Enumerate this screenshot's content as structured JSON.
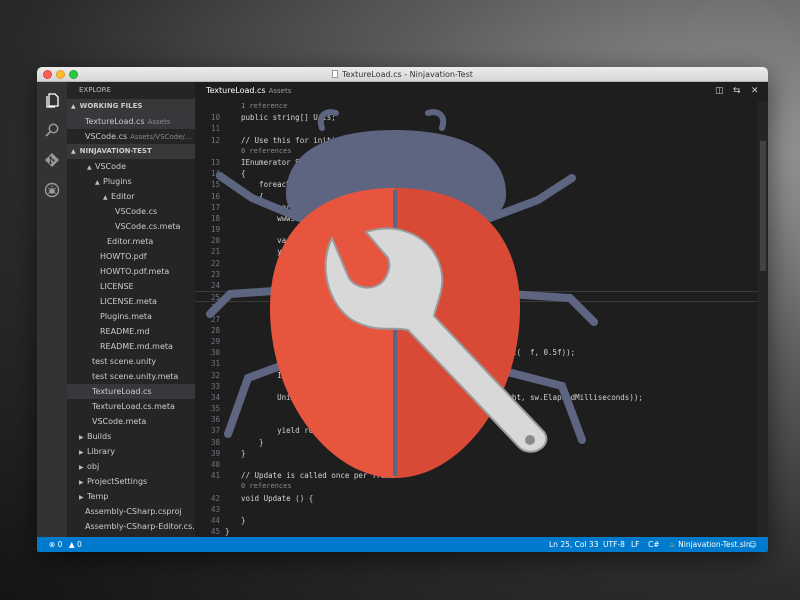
{
  "window": {
    "title": "TextureLoad.cs - Ninjavation-Test"
  },
  "activity_bar": {
    "icons": [
      "files-icon",
      "search-icon",
      "git-icon",
      "debug-icon"
    ]
  },
  "sidebar": {
    "header": "EXPLORE",
    "working_files_title": "WORKING FILES",
    "working_files": [
      {
        "name": "TextureLoad.cs",
        "path": "Assets"
      },
      {
        "name": "VSCode.cs",
        "path": "Assets/VSCode/..."
      }
    ],
    "project_title": "NINJAVATION-TEST",
    "tree": [
      {
        "label": "VSCode",
        "arrow": "▲",
        "indent": 20
      },
      {
        "label": "Plugins",
        "arrow": "▲",
        "indent": 28
      },
      {
        "label": "Editor",
        "arrow": "▲",
        "indent": 36
      },
      {
        "label": "VSCode.cs",
        "arrow": "",
        "indent": 48
      },
      {
        "label": "VSCode.cs.meta",
        "arrow": "",
        "indent": 48
      },
      {
        "label": "Editor.meta",
        "arrow": "",
        "indent": 40
      },
      {
        "label": "HOWTO.pdf",
        "arrow": "",
        "indent": 33
      },
      {
        "label": "HOWTO.pdf.meta",
        "arrow": "",
        "indent": 33
      },
      {
        "label": "LICENSE",
        "arrow": "",
        "indent": 33
      },
      {
        "label": "LICENSE.meta",
        "arrow": "",
        "indent": 33
      },
      {
        "label": "Plugins.meta",
        "arrow": "",
        "indent": 33
      },
      {
        "label": "README.md",
        "arrow": "",
        "indent": 33
      },
      {
        "label": "README.md.meta",
        "arrow": "",
        "indent": 33
      },
      {
        "label": "test scene.unity",
        "arrow": "",
        "indent": 25
      },
      {
        "label": "test scene.unity.meta",
        "arrow": "",
        "indent": 25
      },
      {
        "label": "TextureLoad.cs",
        "arrow": "",
        "indent": 25,
        "selected": true
      },
      {
        "label": "TextureLoad.cs.meta",
        "arrow": "",
        "indent": 25
      },
      {
        "label": "VSCode.meta",
        "arrow": "",
        "indent": 25
      },
      {
        "label": "Builds",
        "arrow": "▶",
        "indent": 12
      },
      {
        "label": "Library",
        "arrow": "▶",
        "indent": 12
      },
      {
        "label": "obj",
        "arrow": "▶",
        "indent": 12
      },
      {
        "label": "ProjectSettings",
        "arrow": "▶",
        "indent": 12
      },
      {
        "label": "Temp",
        "arrow": "▶",
        "indent": 12
      },
      {
        "label": "Assembly-CSharp.csproj",
        "arrow": "",
        "indent": 18
      },
      {
        "label": "Assembly-CSharp-Editor.cs...",
        "arrow": "",
        "indent": 18
      }
    ]
  },
  "editor": {
    "tab": {
      "name": "TextureLoad.cs",
      "folder": "Assets"
    },
    "code_lines": [
      {
        "n": "",
        "t": "1 reference",
        "k": "ref"
      },
      {
        "n": "10",
        "t": "public string[] Urls;",
        "k": "decl"
      },
      {
        "n": "11",
        "t": "",
        "k": ""
      },
      {
        "n": "12",
        "t": "// Use this for initialization",
        "k": "comment"
      },
      {
        "n": "",
        "t": "0 references",
        "k": "ref"
      },
      {
        "n": "13",
        "t": "IEnumerator Start()",
        "k": "type"
      },
      {
        "n": "14",
        "t": "{",
        "k": ""
      },
      {
        "n": "15",
        "t": "    foreach (var ur",
        "k": "kw"
      },
      {
        "n": "16",
        "t": "    {",
        "k": ""
      },
      {
        "n": "17",
        "t": "        var wwwsw =",
        "k": "kw"
      },
      {
        "n": "18",
        "t": "        wwwsw.St",
        "k": ""
      },
      {
        "n": "19",
        "t": "",
        "k": ""
      },
      {
        "n": "20",
        "t": "        var",
        "k": "kw"
      },
      {
        "n": "21",
        "t": "        yield",
        "k": "kw"
      },
      {
        "n": "22",
        "t": "",
        "k": ""
      },
      {
        "n": "23",
        "t": "        U                                     Milliseconds);",
        "k": ""
      },
      {
        "n": "24",
        "t": "",
        "k": ""
      },
      {
        "n": "25",
        "t": "",
        "k": "cur"
      },
      {
        "n": "26",
        "t": "",
        "k": ""
      },
      {
        "n": "27",
        "t": "",
        "k": ""
      },
      {
        "n": "28",
        "t": "",
        "k": ""
      },
      {
        "n": "29",
        "t": "",
        "k": ""
      },
      {
        "n": "30",
        "t": "                                            ght), new Vector2(  f, 0.5f));",
        "k": ""
      },
      {
        "n": "31",
        "t": "",
        "k": ""
      },
      {
        "n": "32",
        "t": "        I",
        "k": ""
      },
      {
        "n": "33",
        "t": "",
        "k": ""
      },
      {
        "n": "34",
        "t": "        Uni                                  h, texture.height, sw.ElapsedMilliseconds));",
        "k": ""
      },
      {
        "n": "35",
        "t": "",
        "k": ""
      },
      {
        "n": "36",
        "t": "",
        "k": ""
      },
      {
        "n": "37",
        "t": "        yield re",
        "k": "kw"
      },
      {
        "n": "38",
        "t": "    }",
        "k": ""
      },
      {
        "n": "39",
        "t": "}",
        "k": ""
      },
      {
        "n": "40",
        "t": "",
        "k": ""
      },
      {
        "n": "41",
        "t": "// Update is called once per frame",
        "k": "comment"
      },
      {
        "n": "",
        "t": "0 references",
        "k": "ref"
      },
      {
        "n": "42",
        "t": "void Update () {",
        "k": "kw"
      },
      {
        "n": "43",
        "t": "",
        "k": ""
      },
      {
        "n": "44",
        "t": "}",
        "k": ""
      },
      {
        "n": "45",
        "t": "}",
        "k": "outer"
      }
    ]
  },
  "status_bar": {
    "errors": "0",
    "warnings": "0",
    "position": "Ln 25, Col 33",
    "encoding": "UTF-8",
    "line_ending": "LF",
    "language": "C#",
    "project": "Ninjavation-Test.sln"
  },
  "colors": {
    "status_bar": "#007acc",
    "bug_body": "#e8553f",
    "bug_head": "#5e6580",
    "wrench": "#d8d8d8"
  }
}
